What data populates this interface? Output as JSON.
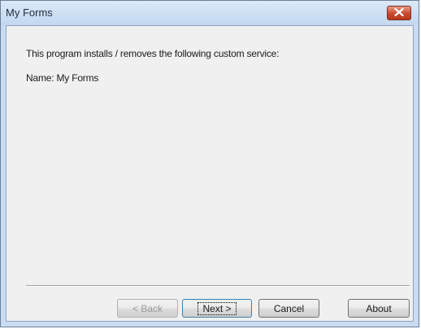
{
  "window": {
    "title": "My Forms"
  },
  "content": {
    "description": "This program installs / removes the following custom service:",
    "name_line": "Name: My Forms"
  },
  "buttons": {
    "back": "< Back",
    "next": "Next >",
    "cancel": "Cancel",
    "about": "About"
  },
  "icons": {
    "close": "close-icon"
  },
  "colors": {
    "close_button": "#c9492e",
    "titlebar": "#c9dcf2",
    "client_bg": "#f0f0f0"
  }
}
